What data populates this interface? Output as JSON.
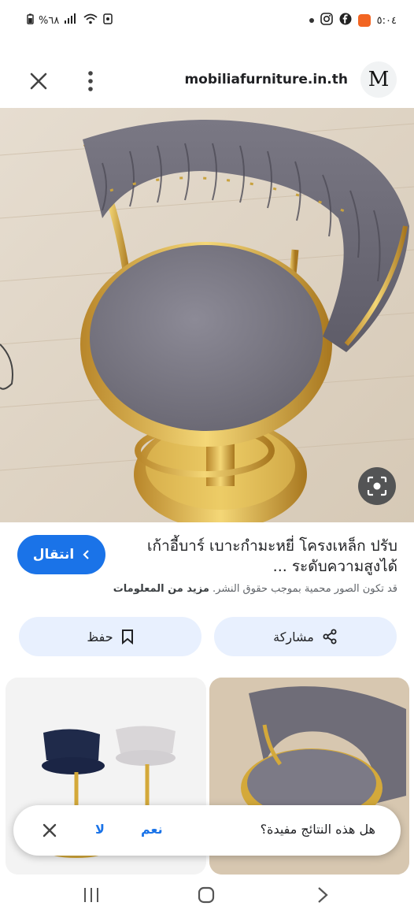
{
  "status_bar": {
    "battery": "%٦٨",
    "time": "٥:٠٤"
  },
  "header": {
    "site_name": "mobiliafurniture.in.th",
    "site_logo_letter": "M"
  },
  "result": {
    "visit_label": "انتقال",
    "title_line1": "เก้าอี้บาร์ เบาะกำมะหยี่ โครงเหล็ก ปรับ",
    "title_line2": "ระดับความสูงได้ ...",
    "copyright_text": "قد تكون الصور محمية بموجب حقوق النشر.",
    "more_info_label": "مزيد من المعلومات"
  },
  "actions": {
    "share_label": "مشاركة",
    "save_label": "حفظ"
  },
  "feedback": {
    "question": "هل هذه النتائج مفيدة؟",
    "yes_label": "نعم",
    "no_label": "لا"
  },
  "colors": {
    "accent": "#1a73e8",
    "chip_bg": "#e8f0fe",
    "velvet_gray": "#7d7b86",
    "gold": "#d4a93a"
  },
  "icons": {
    "close": "close-icon",
    "menu": "more-vert-icon",
    "lens": "lens-icon",
    "share": "share-icon",
    "save": "bookmark-icon"
  }
}
